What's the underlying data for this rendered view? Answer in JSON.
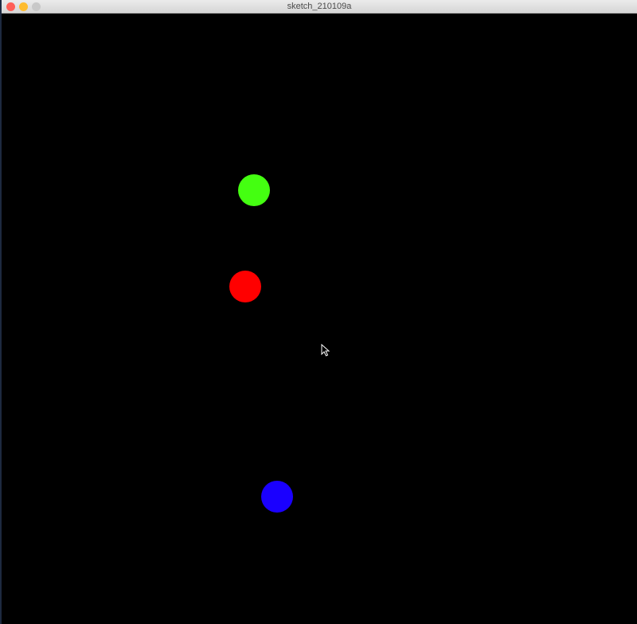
{
  "window": {
    "title": "sketch_210109a",
    "controls": {
      "close_color": "#ff5f57",
      "minimize_color": "#febc2e",
      "zoom_color": "#c8c8c8"
    }
  },
  "canvas": {
    "background": "#000000",
    "circles": [
      {
        "name": "green-circle",
        "color": "#44ff11"
      },
      {
        "name": "red-circle",
        "color": "#ff0000"
      },
      {
        "name": "blue-circle",
        "color": "#1a00ff"
      }
    ]
  },
  "cursor": {
    "icon": "arrow-cursor-icon"
  }
}
